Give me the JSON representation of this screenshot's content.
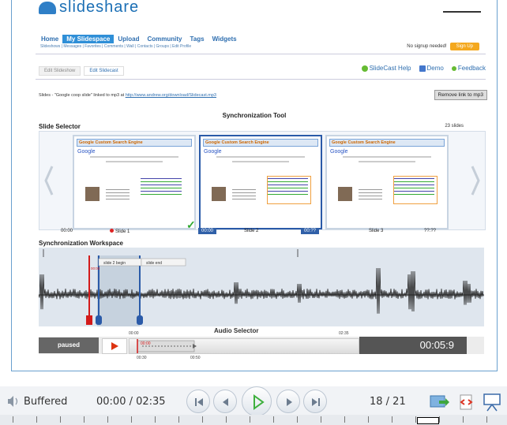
{
  "site": {
    "logo_text": "slideshare"
  },
  "nav": {
    "items": [
      "Home",
      "My Slidespace",
      "Upload",
      "Community",
      "Tags",
      "Widgets"
    ],
    "active_index": 1,
    "subnav": "Slideshows | Messages | Favorites | Comments | Wall | Contacts | Groups | Edit Profile",
    "signup_text": "No signup needed!",
    "signup_button": "Sign Up"
  },
  "tabs": [
    "Edit Slideshow",
    "Edit Slidecast"
  ],
  "help_links": [
    "SlideCast Help",
    "Demo",
    "Feedback"
  ],
  "slides_line": {
    "prefix": "Slides - \"Google coop slide\" linked to mp3 at",
    "url": "http://www.andrew.org/download/Slidecast.mp3"
  },
  "remove_button": "Remove link to mp3",
  "sync_title": "Synchronization Tool",
  "slide_selector": {
    "label": "Slide Selector",
    "count": "23 slides",
    "thumbnails": [
      {
        "title": "Google Custom Search Engine",
        "brand": "Google"
      },
      {
        "title": "Google Custom Search Engine",
        "brand": "Google"
      },
      {
        "title": "Google Custom Search Engine",
        "brand": "Google"
      }
    ],
    "times": [
      "00:00",
      "Slide 1",
      "00:00",
      "Slide 2",
      "00:??",
      "Slide 3",
      "??:??"
    ]
  },
  "workspace": {
    "label": "Synchronization Workspace",
    "tags": [
      "slide 2 begin",
      "slide end"
    ],
    "marker_time": "00:00"
  },
  "audio_selector": {
    "label": "Audio Selector",
    "state_label": "paused",
    "elapsed": "00:05:9",
    "ticks": [
      "00:00",
      "00:30",
      "00:50",
      "02:35"
    ]
  },
  "player": {
    "status": "Buffered",
    "time": "00:00 / 02:35",
    "slide_counter": "18 / 21"
  },
  "colors": {
    "accent": "#2f8fd7",
    "record_red": "#d31a1a",
    "waveform": "#222222"
  }
}
